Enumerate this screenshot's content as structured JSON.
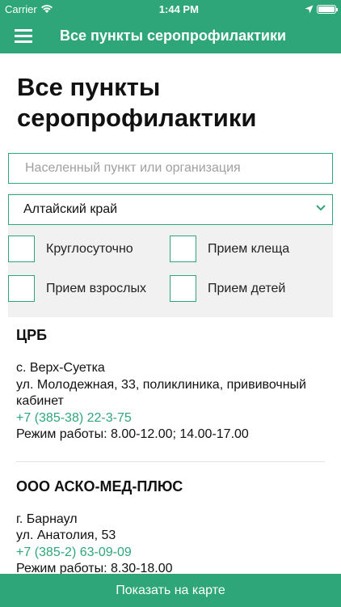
{
  "status_bar": {
    "carrier": "Carrier",
    "time": "1:44 PM"
  },
  "navbar": {
    "title": "Все пункты серопрофилактики",
    "menu_icon": "hamburger-menu-icon"
  },
  "page": {
    "title_line1": "Все пункты",
    "title_line2": "серопрофилактики"
  },
  "search": {
    "placeholder": "Населенный пункт или организация",
    "value": ""
  },
  "region_select": {
    "value": "Алтайский край"
  },
  "filters": [
    {
      "label": "Круглосуточно",
      "checked": false
    },
    {
      "label": "Прием клеща",
      "checked": false
    },
    {
      "label": "Прием взрослых",
      "checked": false
    },
    {
      "label": "Прием детей",
      "checked": false
    }
  ],
  "results": [
    {
      "name": "ЦРБ",
      "city": "с. Верх-Суетка",
      "address": "ул. Молодежная, 33, поликлиника, прививочный кабинет",
      "phone": "+7 (385-38) 22-3-75",
      "hours": "Режим работы: 8.00-12.00; 14.00-17.00"
    },
    {
      "name": "ООО АСКО-МЕД-ПЛЮС",
      "city": "г. Барнаул",
      "address": "ул. Анатолия, 53",
      "phone": "+7 (385-2) 63-09-09",
      "hours": "Режим работы: 8.30-18.00"
    }
  ],
  "bottom_button": {
    "label": "Показать на карте"
  },
  "colors": {
    "accent": "#2fa67a",
    "filter_bg": "#f1f1f1"
  }
}
